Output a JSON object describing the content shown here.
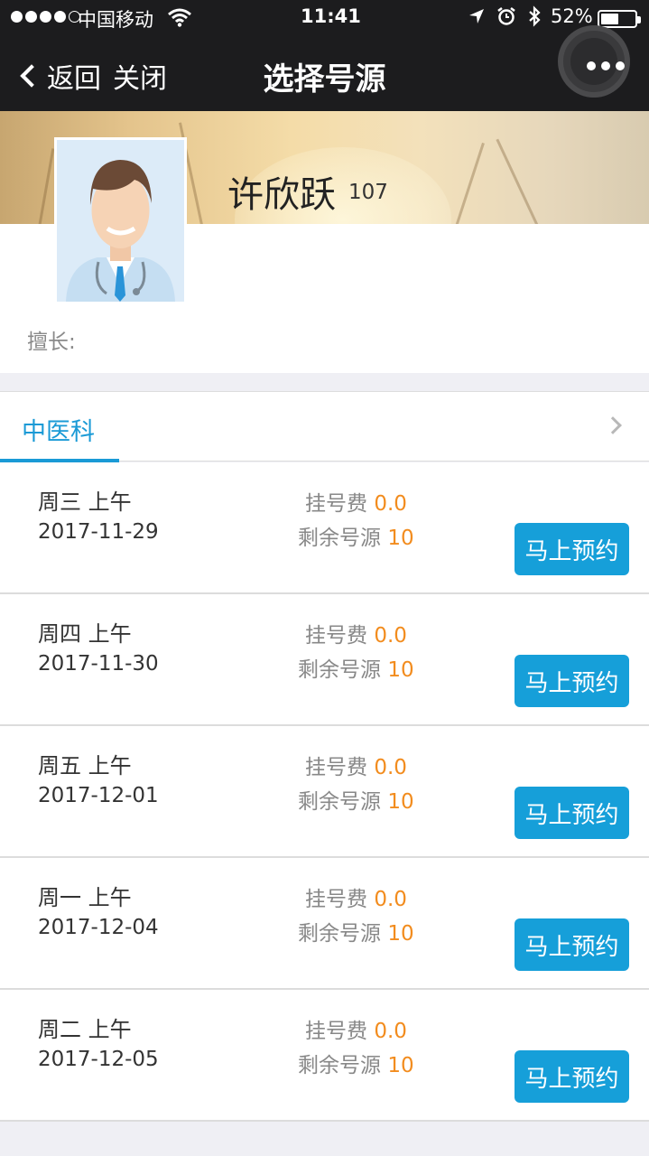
{
  "status_bar": {
    "carrier": "中国移动",
    "time": "11:41",
    "battery_percent": "52%",
    "battery_level": 0.52,
    "icons": [
      "signal-dots-icon",
      "wifi-icon",
      "location-arrow-icon",
      "alarm-icon",
      "bluetooth-icon",
      "battery-icon"
    ]
  },
  "nav": {
    "back_label": "返回",
    "close_label": "关闭",
    "title": "选择号源",
    "more_icon": "more-dots-icon"
  },
  "doctor": {
    "name": "许欣跃",
    "id": "107",
    "specialty_label": "擅长:",
    "avatar_icon": "doctor-avatar-icon"
  },
  "department": {
    "tab_label": "中医科",
    "chevron_icon": "chevron-right-icon"
  },
  "slots": [
    {
      "day": "周三 上午",
      "date": "2017-11-29",
      "fee_label": "挂号费",
      "fee": "0.0",
      "remain_label": "剩余号源",
      "remain": "10",
      "button": "马上预约"
    },
    {
      "day": "周四 上午",
      "date": "2017-11-30",
      "fee_label": "挂号费",
      "fee": "0.0",
      "remain_label": "剩余号源",
      "remain": "10",
      "button": "马上预约"
    },
    {
      "day": "周五 上午",
      "date": "2017-12-01",
      "fee_label": "挂号费",
      "fee": "0.0",
      "remain_label": "剩余号源",
      "remain": "10",
      "button": "马上预约"
    },
    {
      "day": "周一 上午",
      "date": "2017-12-04",
      "fee_label": "挂号费",
      "fee": "0.0",
      "remain_label": "剩余号源",
      "remain": "10",
      "button": "马上预约"
    },
    {
      "day": "周二 上午",
      "date": "2017-12-05",
      "fee_label": "挂号费",
      "fee": "0.0",
      "remain_label": "剩余号源",
      "remain": "10",
      "button": "马上预约"
    }
  ],
  "colors": {
    "accent": "#169fd9",
    "highlight": "#f28c1e",
    "nav_bg": "#1c1c1e",
    "page_bg": "#efeff4"
  }
}
